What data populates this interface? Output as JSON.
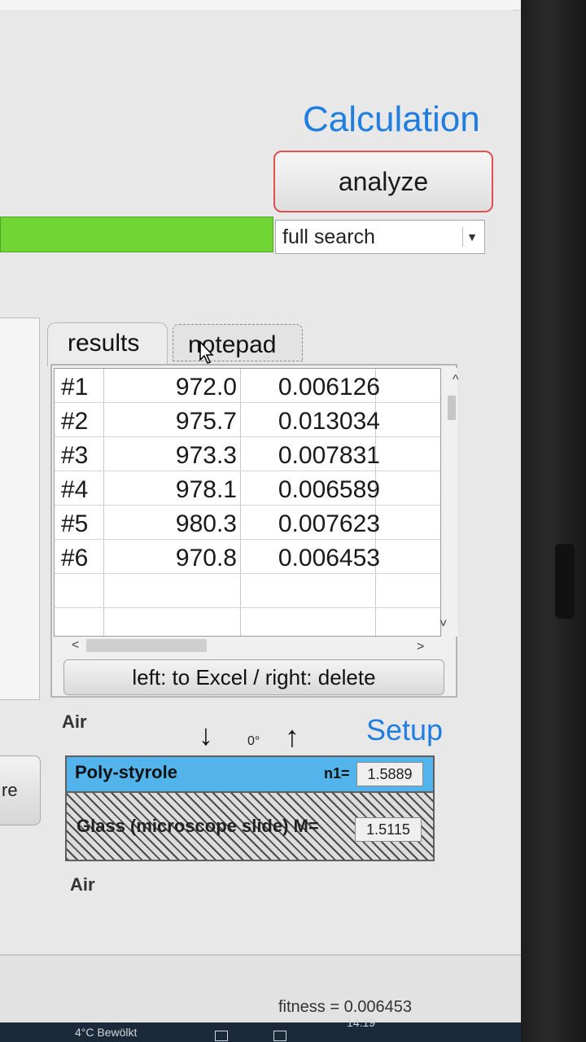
{
  "calculation": {
    "title": "Calculation",
    "analyze_label": "analyze",
    "progress_fraction": 1.0,
    "search_mode": "full search"
  },
  "tabs": [
    {
      "label": "results"
    },
    {
      "label": "notepad"
    }
  ],
  "results": {
    "rows": [
      {
        "id": "#1",
        "a": "972.0",
        "b": "0.006126"
      },
      {
        "id": "#2",
        "a": "975.7",
        "b": "0.013034"
      },
      {
        "id": "#3",
        "a": "973.3",
        "b": "0.007831"
      },
      {
        "id": "#4",
        "a": "978.1",
        "b": "0.006589"
      },
      {
        "id": "#5",
        "a": "980.3",
        "b": "0.007623"
      },
      {
        "id": "#6",
        "a": "970.8",
        "b": "0.006453"
      }
    ],
    "action_label": "left: to Excel / right: delete"
  },
  "left_button_label": "re",
  "setup": {
    "title": "Setup",
    "top_medium": "Air",
    "bottom_medium": "Air",
    "angle": "0°",
    "layers": [
      {
        "name": "Poly-styrole",
        "n_label": "n1=",
        "n_value": "1.5889",
        "color": "#52b4ea"
      },
      {
        "name": "Glass (microscope slide) M=",
        "n_value": "1.5115"
      }
    ]
  },
  "status": {
    "fitness": "fitness = 0.006453"
  },
  "taskbar": {
    "weather": "4°C Bewölkt",
    "time": "14:19"
  },
  "colors": {
    "accent": "#1f7ee0",
    "progress": "#6fd634",
    "analyze_border": "#e05050"
  }
}
